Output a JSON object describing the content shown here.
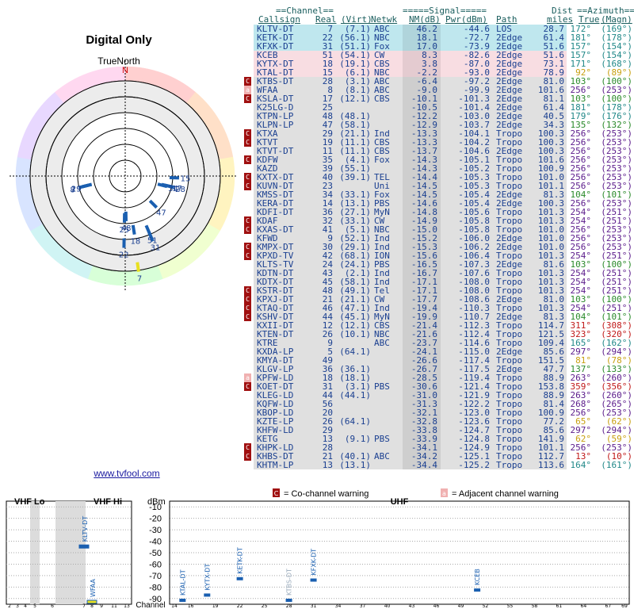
{
  "title": "Digital Only",
  "compass_label": "TrueNorth",
  "north_marker": "N",
  "website": "www.tvfool.com",
  "table_header": {
    "group_channel": "==Channel==",
    "group_signal": "=====Signal=====",
    "group_dist": "Dist",
    "group_azimuth": "==Azimuth==",
    "cols": [
      "Callsign",
      "Real",
      "(Virt)",
      "Netwk",
      "NM(dB)",
      "Pwr(dBm)",
      "Path",
      "miles",
      "True",
      "(Magn)"
    ]
  },
  "stations": [
    {
      "callsign": "KLTV-DT",
      "real": "7",
      "virt": "(7.1)",
      "net": "ABC",
      "nm": "46.2",
      "pwr": "-44.6",
      "path": "LOS",
      "dist": "28.7",
      "true": "172°",
      "magn": "(169°)",
      "bg": "#bfe7ee",
      "flag": ""
    },
    {
      "callsign": "KETK-DT",
      "real": "22",
      "virt": "(56.1)",
      "net": "NBC",
      "nm": "18.1",
      "pwr": "-72.7",
      "path": "2Edge",
      "dist": "61.4",
      "true": "181°",
      "magn": "(178°)",
      "bg": "#bfe7ee",
      "flag": ""
    },
    {
      "callsign": "KFXK-DT",
      "real": "31",
      "virt": "(51.1)",
      "net": "Fox",
      "nm": "17.0",
      "pwr": "-73.9",
      "path": "2Edge",
      "dist": "51.6",
      "true": "157°",
      "magn": "(154°)",
      "bg": "#bfe7ee",
      "flag": ""
    },
    {
      "callsign": "KCEB",
      "real": "51",
      "virt": "(54.1)",
      "net": "CW",
      "nm": "8.3",
      "pwr": "-82.6",
      "path": "2Edge",
      "dist": "51.6",
      "true": "157°",
      "magn": "(154°)",
      "bg": "#f8dde2",
      "flag": ""
    },
    {
      "callsign": "KYTX-DT",
      "real": "18",
      "virt": "(19.1)",
      "net": "CBS",
      "nm": "3.8",
      "pwr": "-87.0",
      "path": "2Edge",
      "dist": "73.1",
      "true": "171°",
      "magn": "(168°)",
      "bg": "#f8dde2",
      "flag": ""
    },
    {
      "callsign": "KTAL-DT",
      "real": "15",
      "virt": "(6.1)",
      "net": "NBC",
      "nm": "-2.2",
      "pwr": "-93.0",
      "path": "2Edge",
      "dist": "78.9",
      "true": "92°",
      "magn": "(89°)",
      "bg": "#f8dde2",
      "flag": ""
    },
    {
      "callsign": "KTBS-DT",
      "real": "28",
      "virt": "(3.1)",
      "net": "ABC",
      "nm": "-6.4",
      "pwr": "-97.2",
      "path": "2Edge",
      "dist": "81.0",
      "true": "103°",
      "magn": "(100°)",
      "bg": "#e0e0e0",
      "flag": "C"
    },
    {
      "callsign": "WFAA",
      "real": "8",
      "virt": "(8.1)",
      "net": "ABC",
      "nm": "-9.0",
      "pwr": "-99.9",
      "path": "2Edge",
      "dist": "101.6",
      "true": "256°",
      "magn": "(253°)",
      "bg": "#e0e0e0",
      "flag": "a"
    },
    {
      "callsign": "KSLA-DT",
      "real": "17",
      "virt": "(12.1)",
      "net": "CBS",
      "nm": "-10.1",
      "pwr": "-101.3",
      "path": "2Edge",
      "dist": "81.1",
      "true": "103°",
      "magn": "(100°)",
      "bg": "#e0e0e0",
      "flag": "C"
    },
    {
      "callsign": "K25LG-D",
      "real": "25",
      "virt": "",
      "net": "",
      "nm": "-10.5",
      "pwr": "-101.4",
      "path": "2Edge",
      "dist": "61.4",
      "true": "181°",
      "magn": "(178°)",
      "bg": "#e0e0e0",
      "flag": ""
    },
    {
      "callsign": "KTPN-LP",
      "real": "48",
      "virt": "(48.1)",
      "net": "",
      "nm": "-12.2",
      "pwr": "-103.0",
      "path": "2Edge",
      "dist": "40.5",
      "true": "179°",
      "magn": "(176°)",
      "bg": "#e0e0e0",
      "flag": ""
    },
    {
      "callsign": "KLPN-LP",
      "real": "47",
      "virt": "(58.1)",
      "net": "",
      "nm": "-12.9",
      "pwr": "-103.7",
      "path": "2Edge",
      "dist": "34.3",
      "true": "135°",
      "magn": "(132°)",
      "bg": "#e0e0e0",
      "flag": ""
    },
    {
      "callsign": "KTXA",
      "real": "29",
      "virt": "(21.1)",
      "net": "Ind",
      "nm": "-13.3",
      "pwr": "-104.1",
      "path": "Tropo",
      "dist": "100.3",
      "true": "256°",
      "magn": "(253°)",
      "bg": "#e0e0e0",
      "flag": "C"
    },
    {
      "callsign": "KTVT",
      "real": "19",
      "virt": "(11.1)",
      "net": "CBS",
      "nm": "-13.3",
      "pwr": "-104.2",
      "path": "Tropo",
      "dist": "100.3",
      "true": "256°",
      "magn": "(253°)",
      "bg": "#e0e0e0",
      "flag": "C"
    },
    {
      "callsign": "KTVT-DT",
      "real": "11",
      "virt": "(11.1)",
      "net": "CBS",
      "nm": "-13.7",
      "pwr": "-104.6",
      "path": "2Edge",
      "dist": "100.3",
      "true": "256°",
      "magn": "(253°)",
      "bg": "#e0e0e0",
      "flag": ""
    },
    {
      "callsign": "KDFW",
      "real": "35",
      "virt": "(4.1)",
      "net": "Fox",
      "nm": "-14.3",
      "pwr": "-105.1",
      "path": "Tropo",
      "dist": "101.6",
      "true": "256°",
      "magn": "(253°)",
      "bg": "#e0e0e0",
      "flag": "C"
    },
    {
      "callsign": "KAZD",
      "real": "39",
      "virt": "(55.1)",
      "net": "",
      "nm": "-14.3",
      "pwr": "-105.2",
      "path": "Tropo",
      "dist": "100.9",
      "true": "256°",
      "magn": "(253°)",
      "bg": "#e0e0e0",
      "flag": ""
    },
    {
      "callsign": "KXTX-DT",
      "real": "40",
      "virt": "(39.1)",
      "net": "TEL",
      "nm": "-14.4",
      "pwr": "-105.3",
      "path": "Tropo",
      "dist": "101.0",
      "true": "256°",
      "magn": "(253°)",
      "bg": "#e0e0e0",
      "flag": "C"
    },
    {
      "callsign": "KUVN-DT",
      "real": "23",
      "virt": "",
      "net": "Uni",
      "nm": "-14.5",
      "pwr": "-105.3",
      "path": "Tropo",
      "dist": "101.1",
      "true": "256°",
      "magn": "(253°)",
      "bg": "#e0e0e0",
      "flag": "C"
    },
    {
      "callsign": "KMSS-DT",
      "real": "34",
      "virt": "(33.1)",
      "net": "Fox",
      "nm": "-14.5",
      "pwr": "-105.4",
      "path": "2Edge",
      "dist": "81.3",
      "true": "104°",
      "magn": "(101°)",
      "bg": "#e0e0e0",
      "flag": ""
    },
    {
      "callsign": "KERA-DT",
      "real": "14",
      "virt": "(13.1)",
      "net": "PBS",
      "nm": "-14.6",
      "pwr": "-105.4",
      "path": "2Edge",
      "dist": "100.3",
      "true": "256°",
      "magn": "(253°)",
      "bg": "#e0e0e0",
      "flag": ""
    },
    {
      "callsign": "KDFI-DT",
      "real": "36",
      "virt": "(27.1)",
      "net": "MyN",
      "nm": "-14.8",
      "pwr": "-105.6",
      "path": "Tropo",
      "dist": "101.3",
      "true": "254°",
      "magn": "(251°)",
      "bg": "#e0e0e0",
      "flag": ""
    },
    {
      "callsign": "KDAF",
      "real": "32",
      "virt": "(33.1)",
      "net": "CW",
      "nm": "-14.9",
      "pwr": "-105.8",
      "path": "Tropo",
      "dist": "101.3",
      "true": "254°",
      "magn": "(251°)",
      "bg": "#e0e0e0",
      "flag": "C"
    },
    {
      "callsign": "KXAS-DT",
      "real": "41",
      "virt": "(5.1)",
      "net": "NBC",
      "nm": "-15.0",
      "pwr": "-105.8",
      "path": "Tropo",
      "dist": "101.0",
      "true": "256°",
      "magn": "(253°)",
      "bg": "#e0e0e0",
      "flag": "C"
    },
    {
      "callsign": "KFWD",
      "real": "9",
      "virt": "(52.1)",
      "net": "Ind",
      "nm": "-15.2",
      "pwr": "-106.0",
      "path": "2Edge",
      "dist": "101.0",
      "true": "256°",
      "magn": "(253°)",
      "bg": "#e0e0e0",
      "flag": ""
    },
    {
      "callsign": "KMPX-DT",
      "real": "30",
      "virt": "(29.1)",
      "net": "Ind",
      "nm": "-15.3",
      "pwr": "-106.2",
      "path": "2Edge",
      "dist": "101.0",
      "true": "256°",
      "magn": "(253°)",
      "bg": "#e0e0e0",
      "flag": "C"
    },
    {
      "callsign": "KPXD-TV",
      "real": "42",
      "virt": "(68.1)",
      "net": "ION",
      "nm": "-15.6",
      "pwr": "-106.4",
      "path": "Tropo",
      "dist": "101.3",
      "true": "254°",
      "magn": "(251°)",
      "bg": "#e0e0e0",
      "flag": "C"
    },
    {
      "callsign": "KLTS-TV",
      "real": "24",
      "virt": "(24.1)",
      "net": "PBS",
      "nm": "-16.5",
      "pwr": "-107.3",
      "path": "2Edge",
      "dist": "81.6",
      "true": "103°",
      "magn": "(100°)",
      "bg": "#e0e0e0",
      "flag": ""
    },
    {
      "callsign": "KDTN-DT",
      "real": "43",
      "virt": "(2.1)",
      "net": "Ind",
      "nm": "-16.7",
      "pwr": "-107.6",
      "path": "Tropo",
      "dist": "101.3",
      "true": "254°",
      "magn": "(251°)",
      "bg": "#e0e0e0",
      "flag": ""
    },
    {
      "callsign": "KDTX-DT",
      "real": "45",
      "virt": "(58.1)",
      "net": "Ind",
      "nm": "-17.1",
      "pwr": "-108.0",
      "path": "Tropo",
      "dist": "101.3",
      "true": "254°",
      "magn": "(251°)",
      "bg": "#e0e0e0",
      "flag": ""
    },
    {
      "callsign": "KSTR-DT",
      "real": "48",
      "virt": "(49.1)",
      "net": "Tel",
      "nm": "-17.1",
      "pwr": "-108.0",
      "path": "Tropo",
      "dist": "101.3",
      "true": "254°",
      "magn": "(251°)",
      "bg": "#e0e0e0",
      "flag": "C"
    },
    {
      "callsign": "KPXJ-DT",
      "real": "21",
      "virt": "(21.1)",
      "net": "CW",
      "nm": "-17.7",
      "pwr": "-108.6",
      "path": "2Edge",
      "dist": "81.0",
      "true": "103°",
      "magn": "(100°)",
      "bg": "#e0e0e0",
      "flag": "C"
    },
    {
      "callsign": "KTAQ-DT",
      "real": "46",
      "virt": "(47.1)",
      "net": "Ind",
      "nm": "-19.4",
      "pwr": "-110.3",
      "path": "Tropo",
      "dist": "101.3",
      "true": "254°",
      "magn": "(251°)",
      "bg": "#e0e0e0",
      "flag": "C"
    },
    {
      "callsign": "KSHV-DT",
      "real": "44",
      "virt": "(45.1)",
      "net": "MyN",
      "nm": "-19.9",
      "pwr": "-110.7",
      "path": "2Edge",
      "dist": "81.3",
      "true": "104°",
      "magn": "(101°)",
      "bg": "#e0e0e0",
      "flag": "C"
    },
    {
      "callsign": "KXII-DT",
      "real": "12",
      "virt": "(12.1)",
      "net": "CBS",
      "nm": "-21.4",
      "pwr": "-112.3",
      "path": "Tropo",
      "dist": "114.7",
      "true": "311°",
      "magn": "(308°)",
      "bg": "#e0e0e0",
      "flag": ""
    },
    {
      "callsign": "KTEN-DT",
      "real": "26",
      "virt": "(10.1)",
      "net": "NBC",
      "nm": "-21.6",
      "pwr": "-112.4",
      "path": "Tropo",
      "dist": "121.5",
      "true": "323°",
      "magn": "(320°)",
      "bg": "#e0e0e0",
      "flag": ""
    },
    {
      "callsign": "KTRE",
      "real": "9",
      "virt": "",
      "net": "ABC",
      "nm": "-23.7",
      "pwr": "-114.6",
      "path": "Tropo",
      "dist": "109.4",
      "true": "165°",
      "magn": "(162°)",
      "bg": "#e0e0e0",
      "flag": ""
    },
    {
      "callsign": "KXDA-LP",
      "real": "5",
      "virt": "(64.1)",
      "net": "",
      "nm": "-24.1",
      "pwr": "-115.0",
      "path": "2Edge",
      "dist": "85.6",
      "true": "297°",
      "magn": "(294°)",
      "bg": "#e0e0e0",
      "flag": ""
    },
    {
      "callsign": "KMYA-DT",
      "real": "49",
      "virt": "",
      "net": "",
      "nm": "-26.6",
      "pwr": "-117.4",
      "path": "Tropo",
      "dist": "151.5",
      "true": "81°",
      "magn": "(78°)",
      "bg": "#e0e0e0",
      "flag": ""
    },
    {
      "callsign": "KLGV-LP",
      "real": "36",
      "virt": "(36.1)",
      "net": "",
      "nm": "-26.7",
      "pwr": "-117.5",
      "path": "2Edge",
      "dist": "47.7",
      "true": "137°",
      "magn": "(133°)",
      "bg": "#e0e0e0",
      "flag": ""
    },
    {
      "callsign": "KPFW-LD",
      "real": "18",
      "virt": "(18.1)",
      "net": "",
      "nm": "-28.5",
      "pwr": "-119.4",
      "path": "Tropo",
      "dist": "88.9",
      "true": "263°",
      "magn": "(260°)",
      "bg": "#e0e0e0",
      "flag": "a"
    },
    {
      "callsign": "KOET-DT",
      "real": "31",
      "virt": "(3.1)",
      "net": "PBS",
      "nm": "-30.6",
      "pwr": "-121.4",
      "path": "Tropo",
      "dist": "153.8",
      "true": "359°",
      "magn": "(356°)",
      "bg": "#e0e0e0",
      "flag": "C"
    },
    {
      "callsign": "KLEG-LD",
      "real": "44",
      "virt": "(44.1)",
      "net": "",
      "nm": "-31.0",
      "pwr": "-121.9",
      "path": "Tropo",
      "dist": "88.9",
      "true": "263°",
      "magn": "(260°)",
      "bg": "#e0e0e0",
      "flag": ""
    },
    {
      "callsign": "KQFW-LD",
      "real": "56",
      "virt": "",
      "net": "",
      "nm": "-31.3",
      "pwr": "-122.2",
      "path": "Tropo",
      "dist": "81.4",
      "true": "268°",
      "magn": "(265°)",
      "bg": "#e0e0e0",
      "flag": ""
    },
    {
      "callsign": "KBOP-LD",
      "real": "20",
      "virt": "",
      "net": "",
      "nm": "-32.1",
      "pwr": "-123.0",
      "path": "Tropo",
      "dist": "100.9",
      "true": "256°",
      "magn": "(253°)",
      "bg": "#e0e0e0",
      "flag": ""
    },
    {
      "callsign": "KZTE-LP",
      "real": "26",
      "virt": "(64.1)",
      "net": "",
      "nm": "-32.8",
      "pwr": "-123.6",
      "path": "Tropo",
      "dist": "77.2",
      "true": "65°",
      "magn": "(62°)",
      "bg": "#e0e0e0",
      "flag": ""
    },
    {
      "callsign": "KHFW-LD",
      "real": "29",
      "virt": "",
      "net": "",
      "nm": "-33.8",
      "pwr": "-124.7",
      "path": "Tropo",
      "dist": "85.6",
      "true": "297°",
      "magn": "(294°)",
      "bg": "#e0e0e0",
      "flag": ""
    },
    {
      "callsign": "KETG",
      "real": "13",
      "virt": "(9.1)",
      "net": "PBS",
      "nm": "-33.9",
      "pwr": "-124.8",
      "path": "Tropo",
      "dist": "141.9",
      "true": "62°",
      "magn": "(59°)",
      "bg": "#e0e0e0",
      "flag": ""
    },
    {
      "callsign": "KHPK-LD",
      "real": "28",
      "virt": "",
      "net": "",
      "nm": "-34.1",
      "pwr": "-124.9",
      "path": "Tropo",
      "dist": "101.1",
      "true": "256°",
      "magn": "(253°)",
      "bg": "#e0e0e0",
      "flag": "C"
    },
    {
      "callsign": "KHBS-DT",
      "real": "21",
      "virt": "(40.1)",
      "net": "ABC",
      "nm": "-34.2",
      "pwr": "-125.1",
      "path": "Tropo",
      "dist": "112.7",
      "true": "13°",
      "magn": "(10°)",
      "bg": "#e0e0e0",
      "flag": "C"
    },
    {
      "callsign": "KHTM-LP",
      "real": "13",
      "virt": "(13.1)",
      "net": "",
      "nm": "-34.4",
      "pwr": "-125.2",
      "path": "Tropo",
      "dist": "113.6",
      "true": "164°",
      "magn": "(161°)",
      "bg": "#e0e0e0",
      "flag": ""
    }
  ],
  "legend": {
    "cochannel_label": "= Co-channel warning",
    "adjacent_label": "= Adjacent channel warning",
    "cochannel_marker": "C",
    "adjacent_marker": "a"
  },
  "chart_data": [
    {
      "type": "polar",
      "rings": 6,
      "stations": [
        {
          "label": "7",
          "azimuth": 172,
          "strength": 46.2
        },
        {
          "label": "22",
          "azimuth": 181,
          "strength": 18.1
        },
        {
          "label": "31",
          "azimuth": 157,
          "strength": 17.0
        },
        {
          "label": "51",
          "azimuth": 157,
          "strength": 8.3
        },
        {
          "label": "18",
          "azimuth": 171,
          "strength": 3.8
        },
        {
          "label": "15",
          "azimuth": 92,
          "strength": -2.2
        },
        {
          "label": "28",
          "azimuth": 103,
          "strength": -6.4
        },
        {
          "label": "8",
          "azimuth": 256,
          "strength": -9.0
        },
        {
          "label": "17",
          "azimuth": 103,
          "strength": -10.1
        },
        {
          "label": "25",
          "azimuth": 181,
          "strength": -10.5
        },
        {
          "label": "48",
          "azimuth": 179,
          "strength": -12.2
        },
        {
          "label": "47",
          "azimuth": 135,
          "strength": -12.9
        },
        {
          "label": "34",
          "azimuth": 104,
          "strength": -14.5
        },
        {
          "label": "19",
          "azimuth": 256,
          "strength": -13.3
        },
        {
          "label": "29",
          "azimuth": 256,
          "strength": -13.3
        }
      ]
    },
    {
      "type": "bar",
      "title": "VHF",
      "section_labels": [
        "VHF Lo",
        "VHF Hi"
      ],
      "ylabel": "dBm",
      "yticks": [
        "-10",
        "-20",
        "-30",
        "-40",
        "-50",
        "-60",
        "-70",
        "-80",
        "-90"
      ],
      "ylim": [
        -95,
        -5
      ],
      "xticks": [
        "2",
        "3",
        "4",
        "5",
        "6",
        "7",
        "8",
        "9",
        "11",
        "13"
      ],
      "xlabel": "Channel",
      "shaded": [
        [
          "3",
          "4"
        ],
        [
          "5",
          "7"
        ]
      ],
      "stations": [
        {
          "channel": 7,
          "callsign": "KLTV-DT",
          "pwr": -44.6,
          "color": "#1a5fb0"
        },
        {
          "channel": 8,
          "callsign": "WFAA",
          "pwr": -99.9,
          "color": "#1a5fb0"
        }
      ]
    },
    {
      "type": "bar",
      "title": "UHF",
      "xticks": [
        "14",
        "16",
        "19",
        "22",
        "25",
        "28",
        "31",
        "34",
        "37",
        "40",
        "43",
        "46",
        "49",
        "52",
        "55",
        "58",
        "61",
        "64",
        "67",
        "69"
      ],
      "stations": [
        {
          "channel": 15,
          "callsign": "KTAL-DT",
          "pwr": -93.0,
          "color": "#1a5fb0"
        },
        {
          "channel": 18,
          "callsign": "KYTX-DT",
          "pwr": -87.0,
          "color": "#1a5fb0"
        },
        {
          "channel": 22,
          "callsign": "KETK-DT",
          "pwr": -72.7,
          "color": "#1a5fb0"
        },
        {
          "channel": 28,
          "callsign": "KTBS-DT",
          "pwr": -97.2,
          "color": "#1a5fb0"
        },
        {
          "channel": 31,
          "callsign": "KFXK-DT",
          "pwr": -73.9,
          "color": "#1a5fb0"
        },
        {
          "channel": 51,
          "callsign": "KCEB",
          "pwr": -82.6,
          "color": "#1a5fb0"
        }
      ]
    }
  ]
}
